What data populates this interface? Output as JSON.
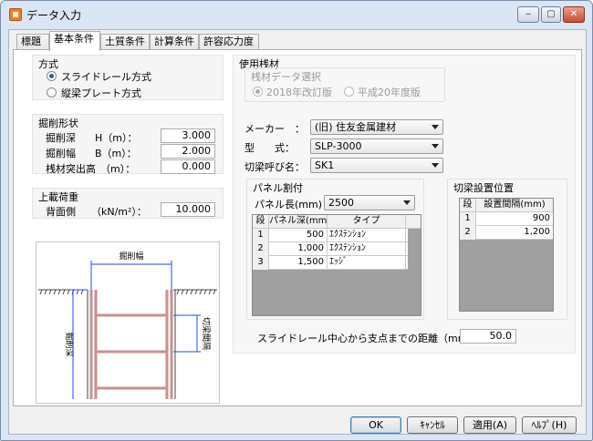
{
  "window": {
    "title": "データ入力",
    "controls": {
      "minimize": "‒",
      "maximize": "▢",
      "close": "✕"
    }
  },
  "tabs": [
    {
      "label": "標題",
      "active": false
    },
    {
      "label": "基本条件",
      "active": true
    },
    {
      "label": "土質条件",
      "active": false
    },
    {
      "label": "計算条件",
      "active": false
    },
    {
      "label": "許容応力度",
      "active": false
    }
  ],
  "method": {
    "title": "方式",
    "options": [
      {
        "label": "スライドレール方式",
        "selected": true
      },
      {
        "label": "縦梁プレート方式",
        "selected": false
      }
    ]
  },
  "excavation": {
    "title": "掘削形状",
    "rows": [
      {
        "label": "掘削深",
        "symbol": "H（m）：",
        "value": "3.000"
      },
      {
        "label": "掘削幅",
        "symbol": "B（m）：",
        "value": "2.000"
      },
      {
        "label": "桟材突出高",
        "symbol": "（m）：",
        "value": "0.000"
      }
    ]
  },
  "surcharge": {
    "title": "上載荷重",
    "label": "背面側",
    "unit": "（kN/m²）：",
    "value": "10.000"
  },
  "material": {
    "title": "使用桟材",
    "data_select": {
      "title": "桟材データ選択",
      "options": [
        {
          "label": "2018年改訂版",
          "selected": true
        },
        {
          "label": "平成20年度版",
          "selected": false
        }
      ]
    },
    "maker": {
      "label": "メーカー　：",
      "value": "(旧) 住友金属建材"
    },
    "type": {
      "label": "型　　式：",
      "value": "SLP-3000"
    },
    "strut": {
      "label": "切梁呼び名：",
      "value": "SK1"
    }
  },
  "panel_split": {
    "title": "パネル割付",
    "length_label": "パネル長(mm)：",
    "length_value": "2500",
    "columns": [
      "段",
      "パネル深(mm)",
      "タイプ"
    ],
    "rows": [
      {
        "no": "1",
        "depth": "500",
        "type": "ｴｸｽﾃﾝｼｮﾝ"
      },
      {
        "no": "2",
        "depth": "1,000",
        "type": "ｴｸｽﾃﾝｼｮﾝ"
      },
      {
        "no": "3",
        "depth": "1,500",
        "type": "ｴｯｼﾞ"
      }
    ]
  },
  "strut_position": {
    "title": "切梁設置位置",
    "columns": [
      "段",
      "設置間隔(mm)"
    ],
    "rows": [
      {
        "no": "1",
        "interval": "900"
      },
      {
        "no": "2",
        "interval": "1,200"
      }
    ]
  },
  "distance": {
    "label": "スライドレール中心から支点までの距離（mm）：",
    "value": "50.0"
  },
  "diagram": {
    "width_label": "掘削幅",
    "depth_label": "掘削深",
    "strut_label": "切梁間隔"
  },
  "buttons": {
    "ok": "OK",
    "cancel": "ｷｬﾝｾﾙ",
    "apply": "適用(A)",
    "help": "ﾍﾙﾌﾟ(H)"
  },
  "colors": {
    "accent_blue": "#2a5aa8",
    "brace_red": "#c99090",
    "dimension_blue": "#1a4cff"
  }
}
